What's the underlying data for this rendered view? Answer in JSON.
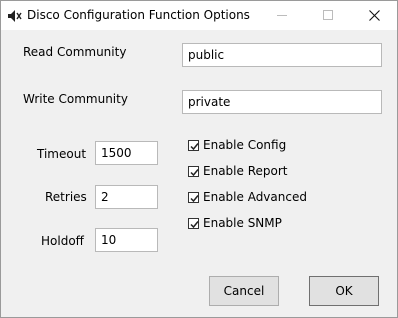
{
  "window": {
    "title": "Disco Configuration Function Options"
  },
  "fields": {
    "read_community": {
      "label": "Read Community",
      "value": "public"
    },
    "write_community": {
      "label": "Write Community",
      "value": "private"
    },
    "timeout": {
      "label": "Timeout",
      "value": "1500"
    },
    "retries": {
      "label": "Retries",
      "value": "2"
    },
    "holdoff": {
      "label": "Holdoff",
      "value": "10"
    }
  },
  "options": [
    {
      "label": "Enable Config",
      "checked": true
    },
    {
      "label": "Enable Report",
      "checked": true
    },
    {
      "label": "Enable Advanced",
      "checked": true
    },
    {
      "label": "Enable SNMP",
      "checked": true
    }
  ],
  "buttons": {
    "cancel": "Cancel",
    "ok": "OK"
  },
  "icons": {
    "app": "speaker-muted-icon",
    "minimize": "minimize-icon",
    "maximize": "maximize-icon",
    "close": "close-icon",
    "check": "check-icon"
  }
}
